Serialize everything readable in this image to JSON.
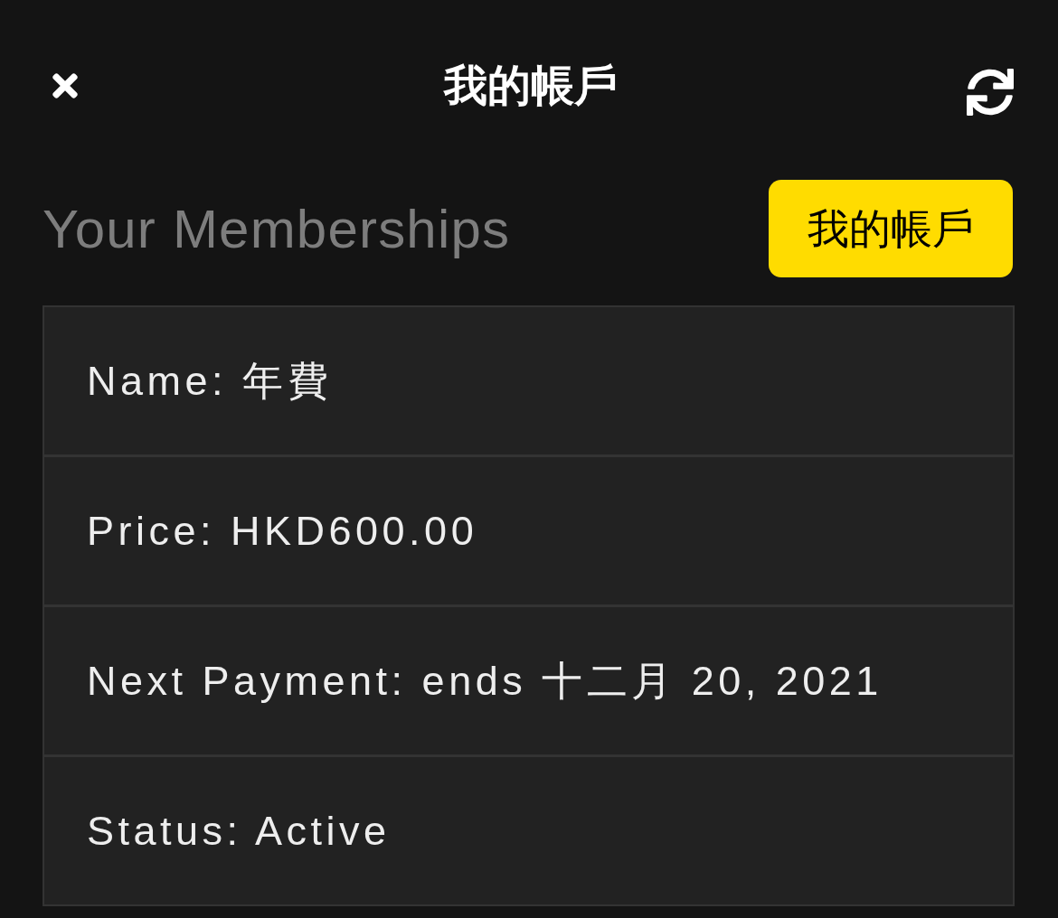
{
  "header": {
    "title": "我的帳戶"
  },
  "section": {
    "title": "Your Memberships",
    "button": "我的帳戶"
  },
  "membership_rows": [
    {
      "text": "Name: 年費"
    },
    {
      "text": "Price: HKD600.00"
    },
    {
      "text": "Next Payment: ends 十二月 20, 2021"
    },
    {
      "text": "Status: Active"
    }
  ]
}
